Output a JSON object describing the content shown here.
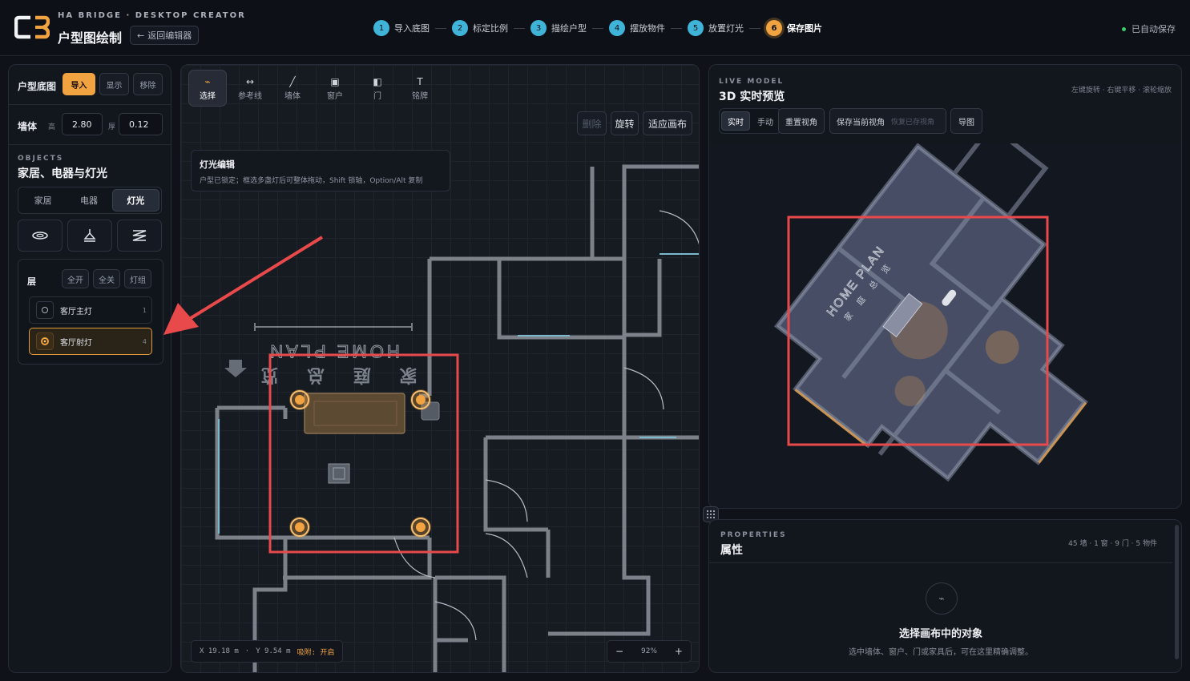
{
  "header": {
    "brand_sub": "HA BRIDGE · DESKTOP CREATOR",
    "title": "户型图绘制",
    "back_label": "返回编辑器",
    "autosave": "已自动保存",
    "steps": [
      {
        "n": "1",
        "label": "导入底图"
      },
      {
        "n": "2",
        "label": "标定比例"
      },
      {
        "n": "3",
        "label": "描绘户型"
      },
      {
        "n": "4",
        "label": "摆放物件"
      },
      {
        "n": "5",
        "label": "放置灯光"
      },
      {
        "n": "6",
        "label": "保存图片"
      }
    ]
  },
  "left": {
    "floor_label": "户型底图",
    "import": "导入",
    "show": "显示",
    "remove": "移除",
    "wall_label": "墙体",
    "height_label": "高",
    "height_value": "2.80",
    "thick_label": "厚",
    "thick_value": "0.12",
    "objects_en": "OBJECTS",
    "objects_title": "家居、电器与灯光",
    "tabs": [
      "家居",
      "电器",
      "灯光"
    ],
    "layer_label": "层",
    "layer_btns": [
      "全开",
      "全关",
      "灯组"
    ],
    "layers": [
      {
        "name": "客厅主灯",
        "count": "1"
      },
      {
        "name": "客厅射灯",
        "count": "4"
      }
    ]
  },
  "canvas": {
    "tools": [
      {
        "label": "选择",
        "glyph": "⌁"
      },
      {
        "label": "参考线",
        "glyph": "↔"
      },
      {
        "label": "墙体",
        "glyph": "╱"
      },
      {
        "label": "窗户",
        "glyph": "▣"
      },
      {
        "label": "门",
        "glyph": "◧"
      },
      {
        "label": "铭牌",
        "glyph": "T"
      }
    ],
    "btn_delete": "删除",
    "btn_rotate": "旋转",
    "btn_fit": "适应画布",
    "info_title": "灯光编辑",
    "info_text": "户型已锁定；框选多盏灯后可整体拖动，Shift 锁轴，Option/Alt 复制",
    "plan_en": "HOME PLAN",
    "plan_cn": "家 庭 总 览",
    "coord_x": "X 19.18 m",
    "coord_sep": "·",
    "coord_y": "Y 9.54 m",
    "snap": "吸附: 开启",
    "zoom_minus": "−",
    "zoom": "92%",
    "zoom_plus": "+"
  },
  "preview": {
    "en": "LIVE MODEL",
    "title": "3D 实时预览",
    "hint": "左键旋转 · 右键平移 · 滚轮缩放",
    "mode": [
      "实时",
      "手动"
    ],
    "reset": "重置视角",
    "save_view": "保存当前视角",
    "restore_view": "恢复已存视角",
    "export": "导图",
    "model_label": "HOME PLAN",
    "model_label_cn": "家 庭 总 览"
  },
  "props": {
    "en": "PROPERTIES",
    "title": "属性",
    "stats": "45 墙 · 1 窗 · 9 门 · 5 物件",
    "empty_title": "选择画布中的对象",
    "empty_text": "选中墙体、窗户、门或家具后，可在这里精确调整。"
  },
  "colors": {
    "accent": "#f0a340",
    "step": "#3fb4d8",
    "annotation": "#e8494a"
  }
}
